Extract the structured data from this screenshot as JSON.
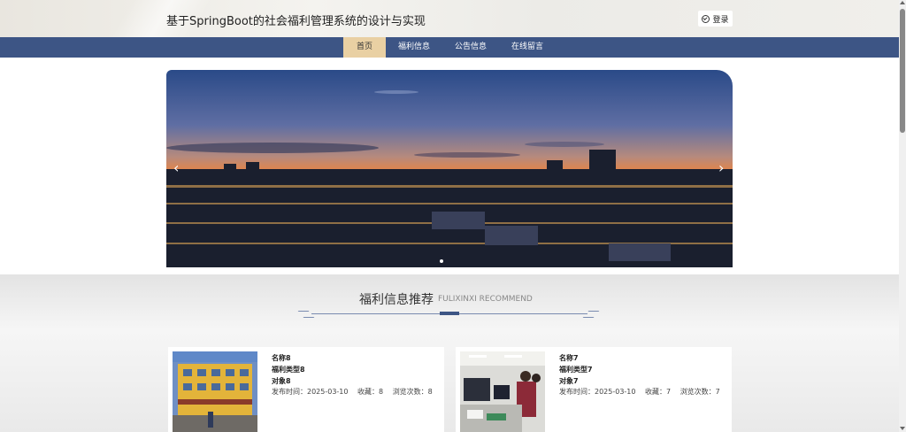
{
  "header": {
    "title": "基于SpringBoot的社会福利管理系统的设计与实现",
    "login_label": "登录"
  },
  "nav": {
    "items": [
      "首页",
      "福利信息",
      "公告信息",
      "在线留言"
    ],
    "active": "首页"
  },
  "banner": {
    "prev_glyph": "‹",
    "next_glyph": "›"
  },
  "recommend": {
    "title": "福利信息推荐",
    "subtitle": "FULIXINXI RECOMMEND",
    "cards": [
      {
        "name": "名称8",
        "type": "福利类型8",
        "target": "对象8",
        "publish": "发布时间：2025-03-10",
        "favorites": "收藏：8",
        "views": "浏览次数：8"
      },
      {
        "name": "名称7",
        "type": "福利类型7",
        "target": "对象7",
        "publish": "发布时间：2025-03-10",
        "favorites": "收藏：7",
        "views": "浏览次数：7"
      }
    ]
  },
  "colors": {
    "nav_bg": "#3d5585",
    "nav_active": "#e9d0a3"
  }
}
